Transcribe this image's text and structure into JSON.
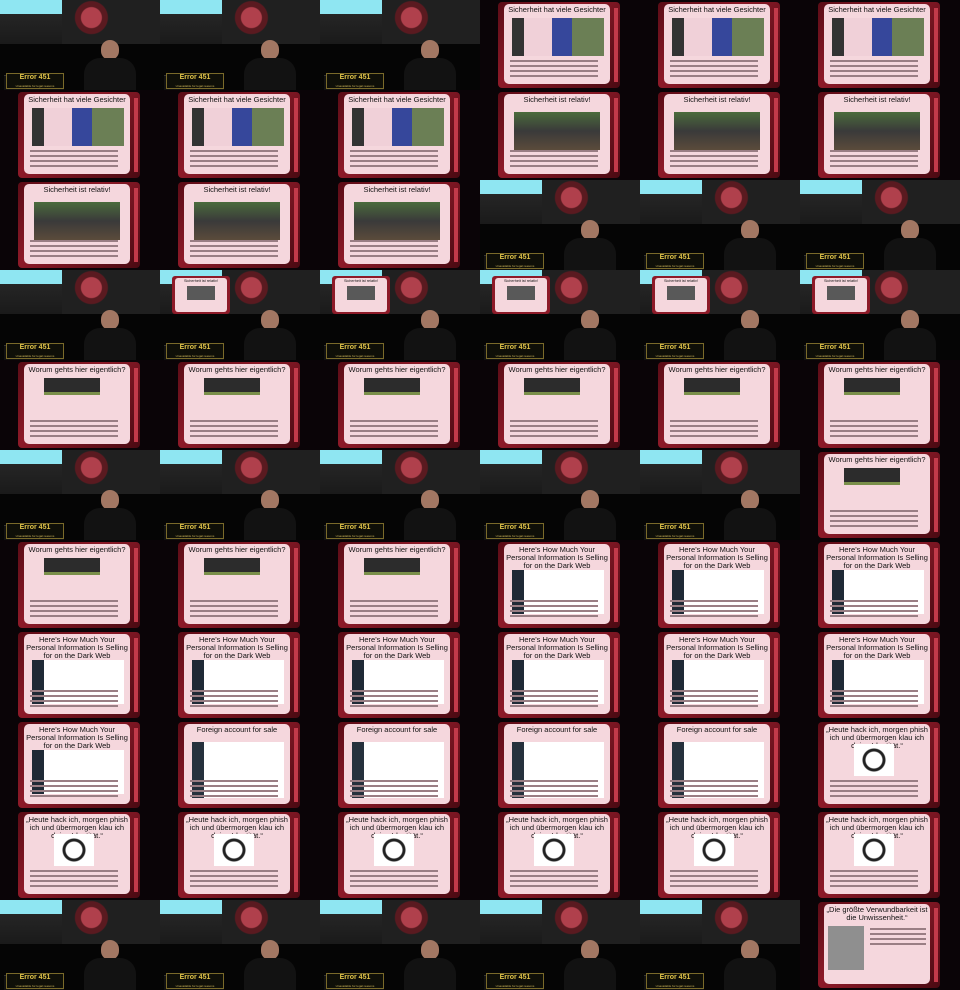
{
  "sign": {
    "line1": "Error 451",
    "line2": "Unavailable for legal reasons"
  },
  "slides": {
    "faces": "Sicherheit hat viele Gesichter",
    "castle": "Sicherheit ist relativ!",
    "device": "Worum gehts hier eigentlich?",
    "table": "Here's How Much Your Personal Information Is Selling for on the Dark Web",
    "account": "Foreign account for sale",
    "hacker": "„Heute hack ich, morgen phish ich und übermorgen klau ich deine Identität.“",
    "statue": "„Die größte Verwundbarkeit ist die Unwissenheit.“"
  },
  "grid": [
    [
      "stage",
      "stage",
      "stage",
      "faces",
      "faces",
      "faces"
    ],
    [
      "faces",
      "faces",
      "faces",
      "castle",
      "castle",
      "castle"
    ],
    [
      "castle",
      "castle",
      "castle",
      "stage",
      "stage",
      "stage"
    ],
    [
      "stage",
      "mini-castle",
      "mini-castle",
      "mini-castle",
      "mini-castle",
      "mini-castle"
    ],
    [
      "device",
      "device",
      "device",
      "device",
      "device",
      "device"
    ],
    [
      "stage",
      "stage",
      "stage",
      "stage",
      "stage",
      "device"
    ],
    [
      "device",
      "device",
      "device",
      "table",
      "table",
      "table"
    ],
    [
      "table",
      "table",
      "table",
      "table",
      "table",
      "table"
    ],
    [
      "table",
      "account",
      "account",
      "account",
      "account",
      "hacker"
    ],
    [
      "hacker",
      "hacker",
      "hacker",
      "hacker",
      "hacker",
      "hacker"
    ],
    [
      "stage",
      "stage",
      "stage",
      "stage",
      "stage",
      "statue"
    ]
  ]
}
